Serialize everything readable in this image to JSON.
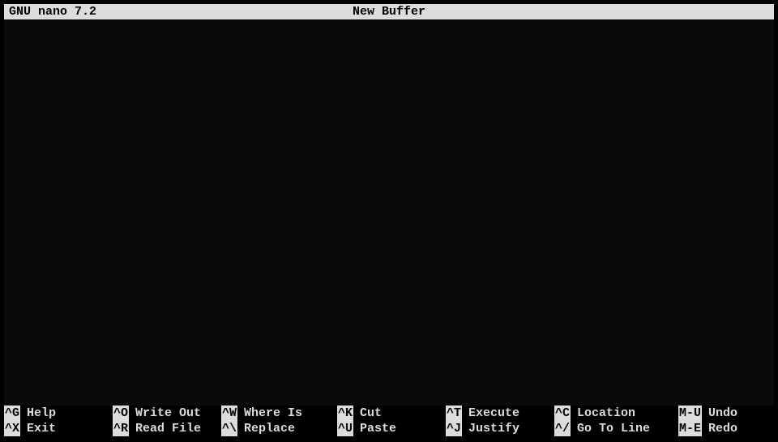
{
  "title_bar": {
    "app_name": "GNU nano 7.2",
    "buffer_name": "New Buffer"
  },
  "shortcuts": {
    "row1": [
      {
        "key": "^G",
        "label": "Help"
      },
      {
        "key": "^O",
        "label": "Write Out"
      },
      {
        "key": "^W",
        "label": "Where Is"
      },
      {
        "key": "^K",
        "label": "Cut"
      },
      {
        "key": "^T",
        "label": "Execute"
      },
      {
        "key": "^C",
        "label": "Location"
      },
      {
        "key": "M-U",
        "label": "Undo"
      }
    ],
    "row2": [
      {
        "key": "^X",
        "label": "Exit"
      },
      {
        "key": "^R",
        "label": "Read File"
      },
      {
        "key": "^\\",
        "label": "Replace"
      },
      {
        "key": "^U",
        "label": "Paste"
      },
      {
        "key": "^J",
        "label": "Justify"
      },
      {
        "key": "^/",
        "label": "Go To Line"
      },
      {
        "key": "M-E",
        "label": "Redo"
      }
    ]
  }
}
